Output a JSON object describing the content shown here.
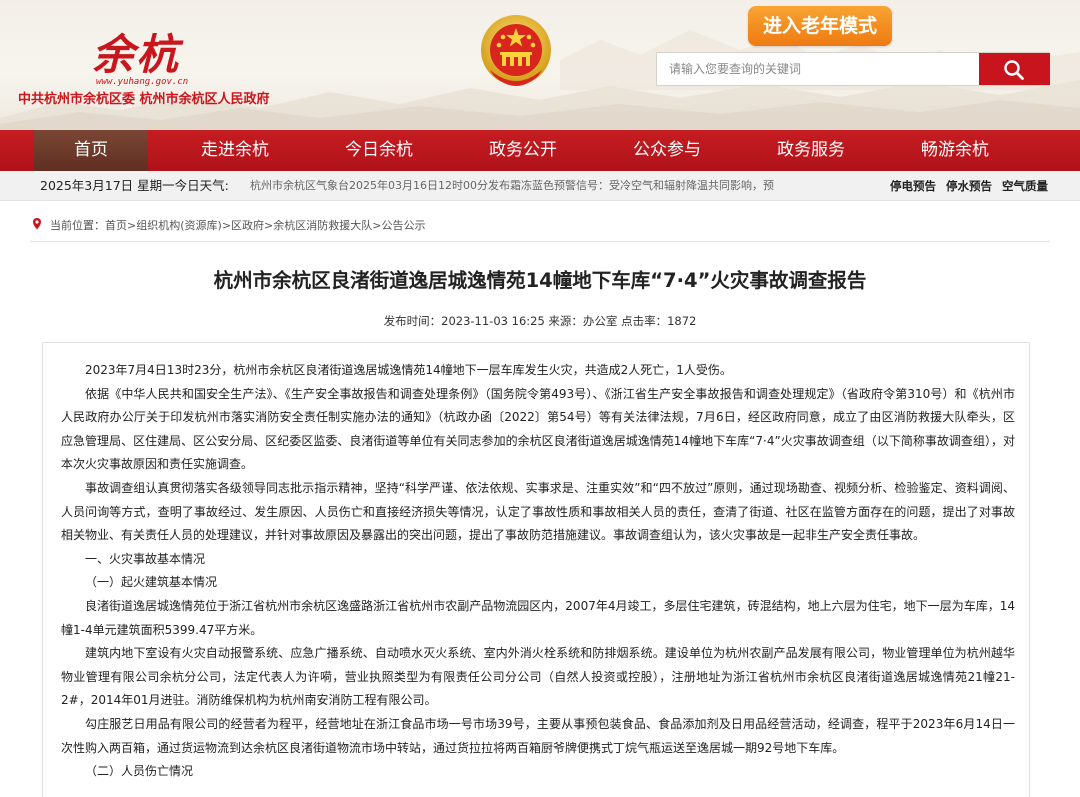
{
  "header": {
    "logo_text": "余杭",
    "logo_url": "www.yuhang.gov.cn",
    "org_name": "中共杭州市余杭区委  杭州市余杭区人民政府",
    "elder_mode_label": "进入老年模式",
    "search": {
      "placeholder": "请输入您要查询的关键词",
      "value": ""
    }
  },
  "nav": {
    "items": [
      {
        "label": "首页",
        "active": true
      },
      {
        "label": "走进余杭"
      },
      {
        "label": "今日余杭"
      },
      {
        "label": "政务公开"
      },
      {
        "label": "公众参与"
      },
      {
        "label": "政务服务"
      },
      {
        "label": "畅游余杭"
      }
    ]
  },
  "ticker": {
    "date": "2025年3月17日 星期一今日天气:",
    "weather": "杭州市余杭区气象台2025年03月16日12时00分发布霜冻蓝色预警信号：受冷空气和辐射降温共同影响，预",
    "quick_links": [
      "停电预告",
      "停水预告",
      "空气质量"
    ]
  },
  "breadcrumb": {
    "prefix": "当前位置：",
    "items": [
      "首页",
      "组织机构(资源库)",
      "区政府",
      "余杭区消防救援大队",
      "公告公示"
    ],
    "separator": ">"
  },
  "article": {
    "title": "杭州市余杭区良渚街道逸居城逸情苑14幢地下车库“7·4”火灾事故调查报告",
    "meta": "发布时间：2023-11-03 16:25 来源：办公室 点击率：1872",
    "paragraphs": [
      "2023年7月4日13时23分，杭州市余杭区良渚街道逸居城逸情苑14幢地下一层车库发生火灾，共造成2人死亡，1人受伤。",
      "依据《中华人民共和国安全生产法》、《生产安全事故报告和调查处理条例》（国务院令第493号）、《浙江省生产安全事故报告和调查处理规定》（省政府令第310号）和《杭州市人民政府办公厅关于印发杭州市落实消防安全责任制实施办法的通知》（杭政办函〔2022〕第54号）等有关法律法规，7月6日，经区政府同意，成立了由区消防救援大队牵头，区应急管理局、区住建局、区公安分局、区纪委区监委、良渚街道等单位有关同志参加的余杭区良渚街道逸居城逸情苑14幢地下车库“7·4”火灾事故调查组（以下简称事故调查组），对本次火灾事故原因和责任实施调查。",
      "事故调查组认真贯彻落实各级领导同志批示指示精神，坚持“科学严谨、依法依规、实事求是、注重实效”和“四不放过”原则，通过现场勘查、视频分析、检验鉴定、资料调阅、人员问询等方式，查明了事故经过、发生原因、人员伤亡和直接经济损失等情况，认定了事故性质和事故相关人员的责任，查清了街道、社区在监管方面存在的问题，提出了对事故相关物业、有关责任人员的处理建议，并针对事故原因及暴露出的突出问题，提出了事故防范措施建议。事故调查组认为，该火灾事故是一起非生产安全责任事故。",
      "一、火灾事故基本情况",
      "（一）起火建筑基本情况",
      "良渚街道逸居城逸情苑位于浙江省杭州市余杭区逸盛路浙江省杭州市农副产品物流园区内，2007年4月竣工，多层住宅建筑，砖混结构，地上六层为住宅，地下一层为车库，14幢1-4单元建筑面积5399.47平方米。",
      "建筑内地下室设有火灾自动报警系统、应急广播系统、自动喷水灭火系统、室内外消火栓系统和防排烟系统。建设单位为杭州农副产品发展有限公司，物业管理单位为杭州越华物业管理有限公司余杭分公司，法定代表人为许嗬，营业执照类型为有限责任公司分公司（自然人投资或控股），注册地址为浙江省杭州市余杭区良渚街道逸居城逸情苑21幢21-2#，2014年01月进驻。消防维保机构为杭州南安消防工程有限公司。",
      "勾庄服艺日用品有限公司的经营者为程平，经营地址在浙江食品市场一号市场39号，主要从事预包装食品、食品添加剂及日用品经营活动，经调查，程平于2023年6月14日一次性购入两百箱，通过货运物流到达余杭区良渚街道物流市场中转站，通过货拉拉将两百箱厨爷牌便携式丁烷气瓶运送至逸居城一期92号地下车库。",
      "（二）人员伤亡情况"
    ]
  },
  "colors": {
    "brand_red": "#c8141c",
    "nav_red": "#b8171d",
    "nav_active": "#6b3727",
    "elder_orange": "#f08a1c"
  }
}
